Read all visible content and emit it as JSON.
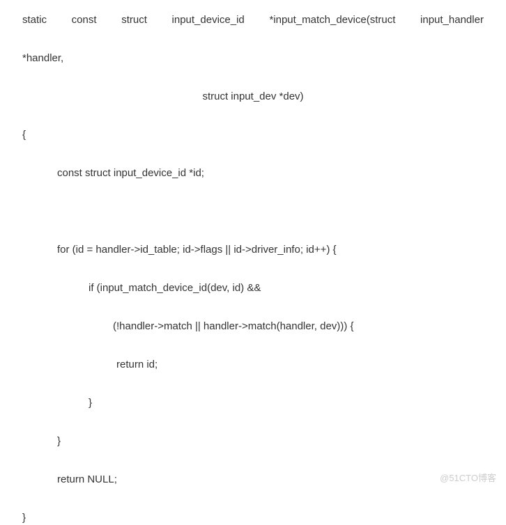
{
  "code": {
    "l1_w1": "static",
    "l1_w2": "const",
    "l1_w3": "struct",
    "l1_w4": "input_device_id",
    "l1_w5": "*input_match_device(struct",
    "l1_w6": "input_handler",
    "l2": "*handler,",
    "l3": "struct input_dev *dev)",
    "l4": "{",
    "l5": "const struct input_device_id *id;",
    "l7": "for (id = handler->id_table; id->flags || id->driver_info; id++) {",
    "l8": "if (input_match_device_id(dev, id) &&",
    "l9": "(!handler->match || handler->match(handler, dev))) {",
    "l10": " return id;",
    "l11": "}",
    "l12": "}",
    "l13": "return NULL;",
    "l14": "}"
  },
  "watermark": "@51CTO博客"
}
